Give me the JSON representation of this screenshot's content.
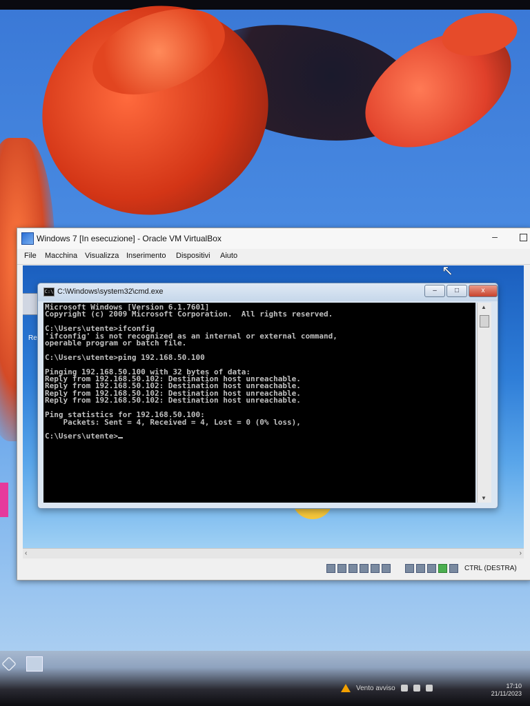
{
  "virtualbox": {
    "title": "Windows 7 [In esecuzione] - Oracle VM VirtualBox",
    "menu": [
      "File",
      "Macchina",
      "Visualizza",
      "Inserimento",
      "Dispositivi",
      "Aiuto"
    ],
    "status_key": "CTRL (DESTRA)"
  },
  "vm_desktop": {
    "recycle_bin_label": "Re"
  },
  "cmd": {
    "title": "C:\\Windows\\system32\\cmd.exe",
    "lines": [
      "Microsoft Windows [Version 6.1.7601]",
      "Copyright (c) 2009 Microsoft Corporation.  All rights reserved.",
      "",
      "C:\\Users\\utente>ifconfig",
      "'ifconfig' is not recognized as an internal or external command,",
      "operable program or batch file.",
      "",
      "C:\\Users\\utente>ping 192.168.50.100",
      "",
      "Pinging 192.168.50.100 with 32 bytes of data:",
      "Reply from 192.168.50.102: Destination host unreachable.",
      "Reply from 192.168.50.102: Destination host unreachable.",
      "Reply from 192.168.50.102: Destination host unreachable.",
      "Reply from 192.168.50.102: Destination host unreachable.",
      "",
      "Ping statistics for 192.168.50.100:",
      "    Packets: Sent = 4, Received = 4, Lost = 0 (0% loss),",
      "",
      "C:\\Users\\utente>"
    ],
    "buttons": {
      "minimize": "–",
      "maximize": "□",
      "close": "x"
    }
  },
  "host_taskbar": {
    "notification": "Vento avviso",
    "time": "17:10",
    "date": "21/11/2023"
  }
}
